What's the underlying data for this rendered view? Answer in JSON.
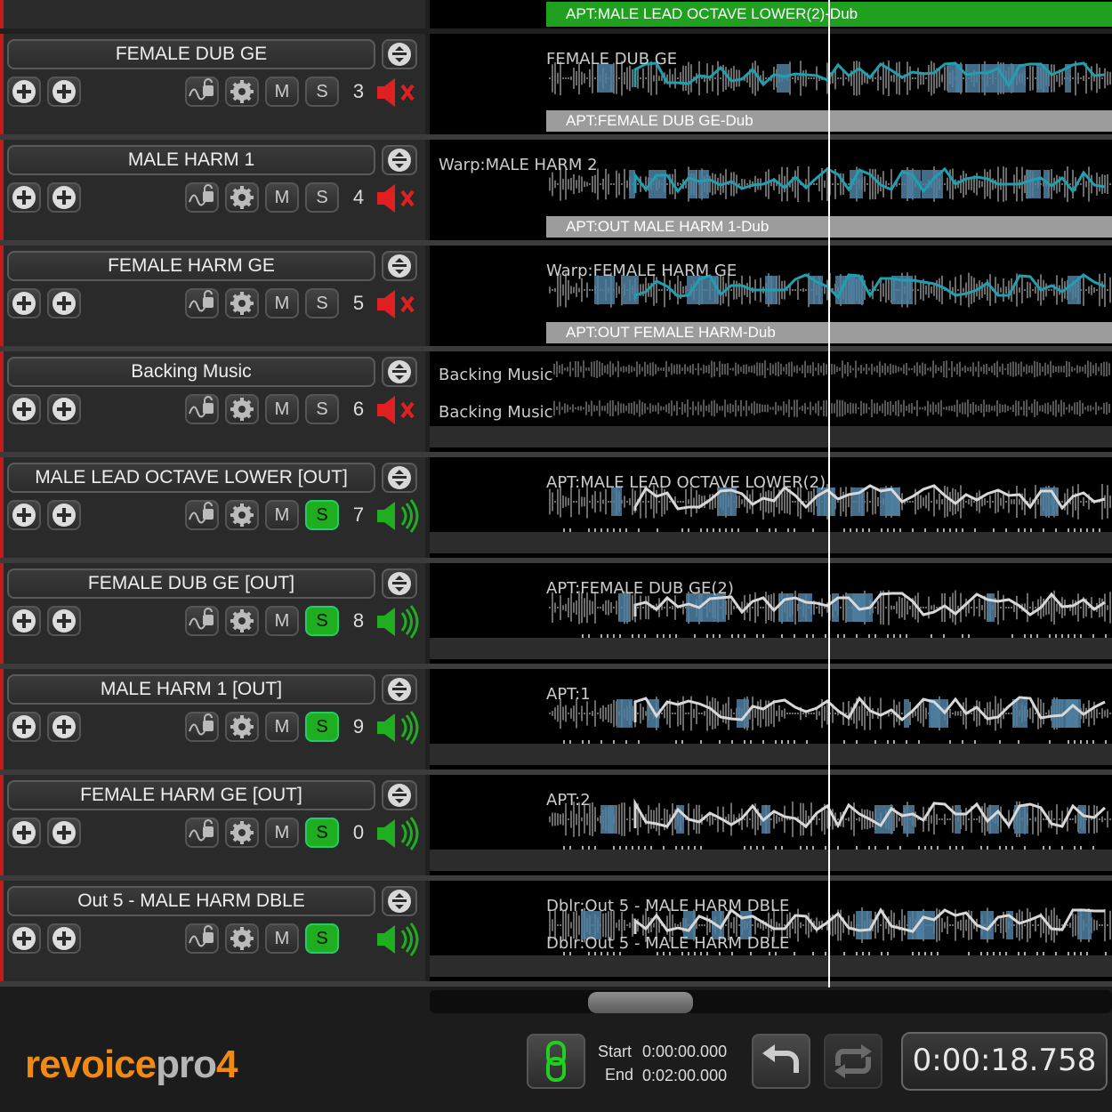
{
  "top_row": {
    "dub_label": "APT:MALE LEAD OCTAVE LOWER(2)-Dub"
  },
  "tracks": [
    {
      "name": "FEMALE DUB GE",
      "number": "3",
      "solo_on": false,
      "muted": true,
      "lane_top": "FEMALE DUB GE",
      "lane_bottom": "",
      "dub": "APT:FEMALE DUB GE-Dub"
    },
    {
      "name": "MALE HARM 1",
      "number": "4",
      "solo_on": false,
      "muted": true,
      "lane_top": "Warp:MALE HARM 2",
      "lane_bottom": "",
      "dub": "APT:OUT MALE HARM 1-Dub"
    },
    {
      "name": "FEMALE HARM GE",
      "number": "5",
      "solo_on": false,
      "muted": true,
      "lane_top": "Warp:FEMALE HARM GE",
      "lane_bottom": "",
      "dub": "APT:OUT FEMALE HARM-Dub"
    },
    {
      "name": "Backing Music",
      "number": "6",
      "solo_on": false,
      "muted": true,
      "lane_top": "Backing Music",
      "lane_bottom": "Backing Music",
      "dub": ""
    },
    {
      "name": "MALE LEAD OCTAVE LOWER [OUT]",
      "number": "7",
      "solo_on": true,
      "muted": false,
      "lane_top": "APT:MALE LEAD OCTAVE LOWER(2)",
      "lane_bottom": "",
      "dub": ""
    },
    {
      "name": "FEMALE DUB GE [OUT]",
      "number": "8",
      "solo_on": true,
      "muted": false,
      "lane_top": "APT:FEMALE DUB GE(2)",
      "lane_bottom": "",
      "dub": ""
    },
    {
      "name": "MALE HARM 1 [OUT]",
      "number": "9",
      "solo_on": true,
      "muted": false,
      "lane_top": "APT:1",
      "lane_bottom": "",
      "dub": ""
    },
    {
      "name": "FEMALE HARM GE [OUT]",
      "number": "0",
      "solo_on": true,
      "muted": false,
      "lane_top": "APT:2",
      "lane_bottom": "",
      "dub": ""
    },
    {
      "name": "Out 5 - MALE HARM DBLE",
      "number": "",
      "solo_on": true,
      "muted": false,
      "lane_top": "Dblr:Out 5 - MALE HARM DBLE",
      "lane_bottom": "Dblr:Out 5 - MALE HARM DBLE",
      "dub": ""
    }
  ],
  "buttons": {
    "mute": "M",
    "solo": "S"
  },
  "footer": {
    "logo_revoice": "revoice",
    "logo_pro": "pro",
    "logo_version": "4",
    "start_label": "Start",
    "start_value": "0:00:00.000",
    "end_label": "End",
    "end_value": "0:02:00.000",
    "timecode": "0:00:18.758"
  },
  "colors": {
    "accent_green": "#1fae1f",
    "mute_red": "#e02020",
    "track_edge_red": "#c41b1b",
    "logo_orange": "#f08a14"
  },
  "icons": [
    "add-icon",
    "warp-lock-icon",
    "gear-icon",
    "menu-updown-icon",
    "speaker-muted-icon",
    "speaker-on-icon",
    "link-icon",
    "undo-icon",
    "loop-icon"
  ]
}
